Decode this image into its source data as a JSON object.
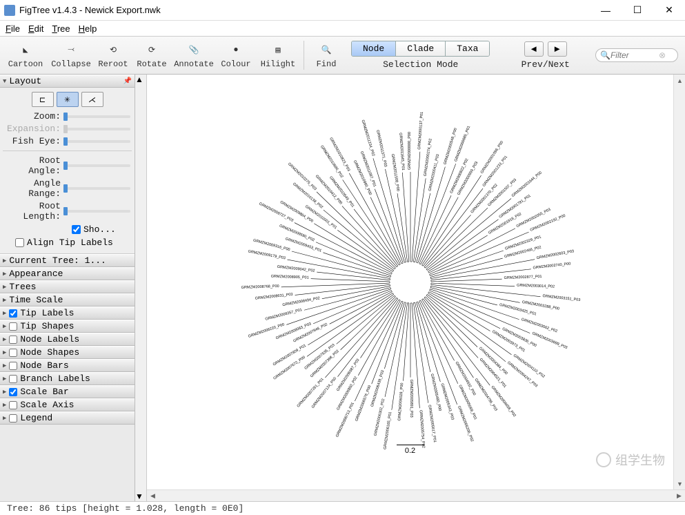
{
  "window": {
    "title": "FigTree v1.4.3 - Newick Export.nwk",
    "minimize": "—",
    "maximize": "☐",
    "close": "✕"
  },
  "menu": {
    "file": "File",
    "edit": "Edit",
    "tree": "Tree",
    "help": "Help"
  },
  "toolbar": {
    "cartoon": "Cartoon",
    "collapse": "Collapse",
    "reroot": "Reroot",
    "rotate": "Rotate",
    "annotate": "Annotate",
    "colour": "Colour",
    "hilight": "Hilight",
    "find": "Find",
    "sel_node": "Node",
    "sel_clade": "Clade",
    "sel_taxa": "Taxa",
    "sel_label": "Selection Mode",
    "nav_label": "Prev/Next",
    "filter_placeholder": "Filter"
  },
  "layout": {
    "header": "Layout",
    "zoom": "Zoom:",
    "expansion": "Expansion:",
    "fisheye": "Fish Eye:",
    "root_angle": "Root Angle:",
    "angle_range": "Angle Range:",
    "root_length": "Root Length:",
    "show": "Sho...",
    "align_tip": "Align Tip Labels"
  },
  "panels": {
    "current_tree": "Current Tree: 1...",
    "appearance": "Appearance",
    "trees": "Trees",
    "time_scale": "Time Scale",
    "tip_labels": "Tip Labels",
    "tip_shapes": "Tip Shapes",
    "node_labels": "Node Labels",
    "node_shapes": "Node Shapes",
    "node_bars": "Node Bars",
    "branch_labels": "Branch Labels",
    "scale_bar": "Scale Bar",
    "scale_axis": "Scale Axis",
    "legend": "Legend"
  },
  "scalebar": {
    "value": "0.2"
  },
  "status": "Tree: 86 tips [height = 1.028, length = 0E0]",
  "watermark": "组学生物"
}
